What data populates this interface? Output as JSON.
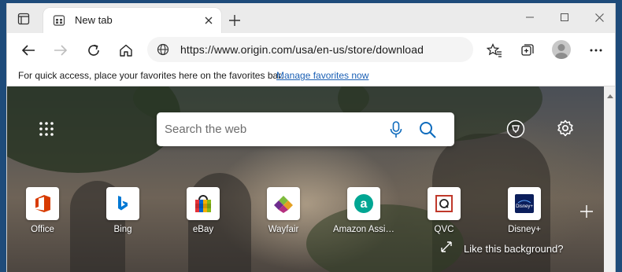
{
  "tab": {
    "title": "New tab"
  },
  "address": {
    "url": "https://www.origin.com/usa/en-us/store/download"
  },
  "favorites_bar": {
    "message": "For quick access, place your favorites here on the favorites bar.",
    "link": "Manage favorites now"
  },
  "search": {
    "placeholder": "Search the web"
  },
  "quick_links": [
    {
      "label": "Office"
    },
    {
      "label": "Bing"
    },
    {
      "label": "eBay"
    },
    {
      "label": "Wayfair"
    },
    {
      "label": "Amazon Assi…"
    },
    {
      "label": "QVC"
    },
    {
      "label": "Disney+"
    }
  ],
  "background": {
    "like_text": "Like this background?"
  },
  "colors": {
    "accent": "#1a5fb4",
    "office": "#d83b01",
    "bing": "#0078d4",
    "amazon": "#00a693",
    "qvc": "#c0392b",
    "disney": "#0b1e5b"
  }
}
